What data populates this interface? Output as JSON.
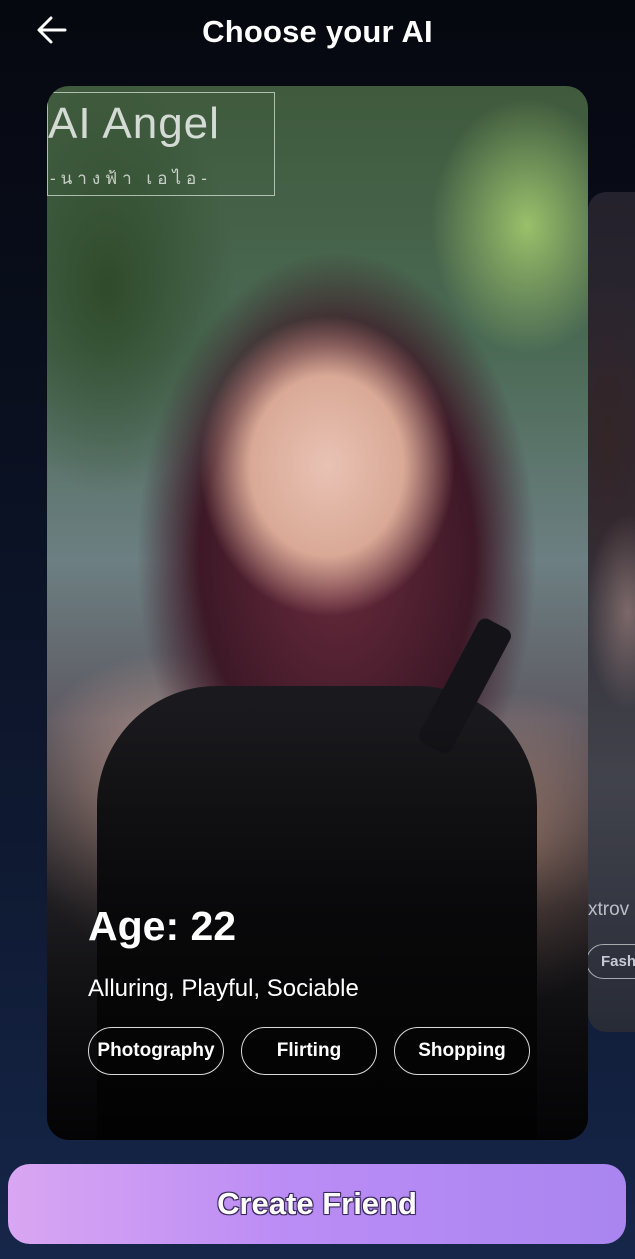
{
  "header": {
    "title": "Choose your AI",
    "back_icon": "arrow-left-icon"
  },
  "card": {
    "image_watermark": {
      "title": "AI Angel",
      "subtitle": "-นางฟ้า เอไอ-"
    },
    "age_label": "Age: 22",
    "traits": "Alluring, Playful, Sociable",
    "tags": [
      "Photography",
      "Flirting",
      "Shopping"
    ]
  },
  "next_card": {
    "traits_partial": "xtrov",
    "tag_partial": "Fash"
  },
  "actions": {
    "create_label": "Create Friend"
  },
  "colors": {
    "background_top": "#06080f",
    "background_bottom": "#16264a",
    "button_gradient_start": "#d9a6f2",
    "button_gradient_end": "#a985f0"
  }
}
